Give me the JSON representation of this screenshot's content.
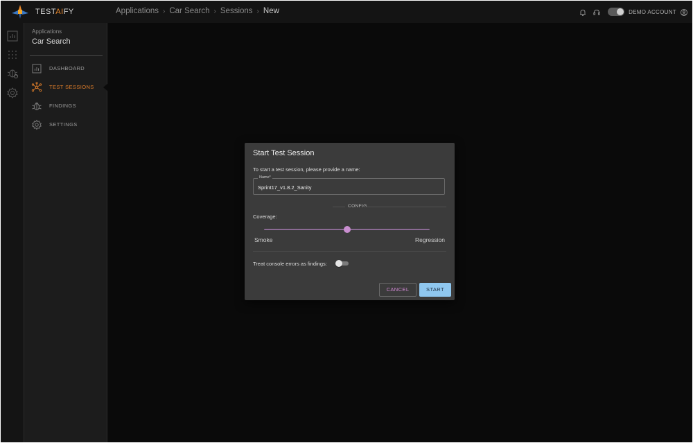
{
  "brand": {
    "name_prefix": "TEST",
    "name_accent": "AI",
    "name_suffix": "FY"
  },
  "rail": {
    "icons": [
      "bar-chart-icon",
      "grid-dots-icon",
      "bug-icon",
      "gear-icon"
    ]
  },
  "sidebar": {
    "context_label": "Applications",
    "context_app": "Car Search",
    "items": [
      {
        "label": "DASHBOARD",
        "icon": "bar-chart-icon",
        "active": false
      },
      {
        "label": "TEST SESSIONS",
        "icon": "network-icon",
        "active": true
      },
      {
        "label": "FINDINGS",
        "icon": "bug-icon",
        "active": false
      },
      {
        "label": "SETTINGS",
        "icon": "gear-icon",
        "active": false
      }
    ]
  },
  "breadcrumbs": [
    "Applications",
    "Car Search",
    "Sessions",
    "New"
  ],
  "topbar": {
    "icons": [
      "bell-icon",
      "headset-icon"
    ],
    "theme_toggle": "dark",
    "account_label": "DEMO ACCOUNT",
    "account_icon": "user-circle-icon"
  },
  "dialog": {
    "title": "Start Test Session",
    "instruction": "To start a test session, please provide a name:",
    "name_field": {
      "label": "Name*",
      "value": "Sprint17_v1.8.2_Sanity"
    },
    "config_label": "CONFIG",
    "coverage": {
      "label": "Coverage:",
      "min_label": "Smoke",
      "max_label": "Regression",
      "value": 0.5
    },
    "console_errors": {
      "label": "Treat console errors as findings:",
      "enabled": false
    },
    "cancel_label": "CANCEL",
    "start_label": "START"
  },
  "colors": {
    "accent_orange": "#e27f2a",
    "slider_accent": "#c98ed0",
    "start_button": "#8fc7ef",
    "cancel_text": "#d38ad6"
  }
}
